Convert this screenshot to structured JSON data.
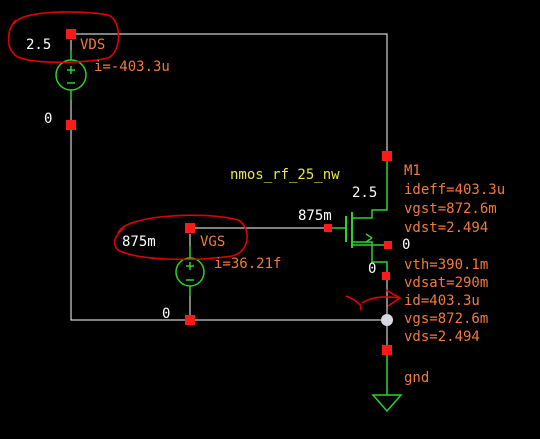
{
  "colors": {
    "background": "#000000",
    "wire": "#ffffff",
    "device": "#2ed12e",
    "pin": "#ff1a1a",
    "annotation_text": "#f07c3c",
    "cell_name": "#e8e84a",
    "net_label": "#ffffff",
    "markup_ink": "#e00000"
  },
  "vds_source": {
    "value": "2.5",
    "name": "VDS",
    "current": "i=-403.3u"
  },
  "vgs_source": {
    "value": "875m",
    "name": "VGS",
    "current": "i=36.21f"
  },
  "net_labels": {
    "vds_bottom": "0",
    "vgs_bottom": "0",
    "gate_wire": "875m",
    "drain_node": "2.5",
    "bulk_node": "0",
    "source_node": "0"
  },
  "transistor": {
    "cell_name": "nmos_rf_25_nw",
    "instance": "M1",
    "op_params": [
      "ideff=403.3u",
      "vgst=872.6m",
      "vdst=2.494",
      "vth=390.1m",
      "vdsat=290m",
      "id=403.3u",
      "vgs=872.6m",
      "vds=2.494"
    ]
  },
  "ground": {
    "label": "gnd"
  }
}
